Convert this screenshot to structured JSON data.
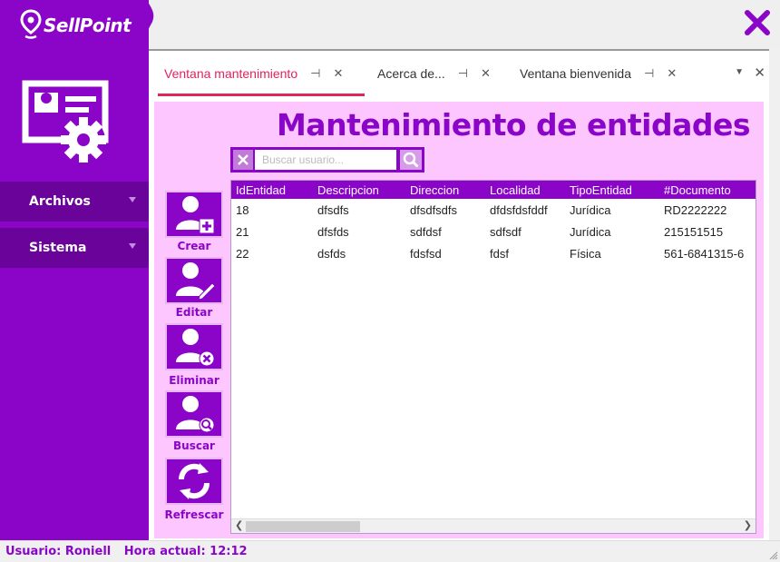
{
  "app": {
    "name": "SellPoint"
  },
  "colors": {
    "brand": "#8a05c8",
    "active_tab": "#e0245e",
    "content_bg": "#fec6ff"
  },
  "sidebar": {
    "items": [
      {
        "label": "Archivos"
      },
      {
        "label": "Sistema"
      }
    ]
  },
  "tabs": [
    {
      "label": "Ventana mantenimiento",
      "active": true
    },
    {
      "label": "Acerca de...",
      "active": false
    },
    {
      "label": "Ventana bienvenida",
      "active": false
    }
  ],
  "page": {
    "title": "Mantenimiento de entidades",
    "search_placeholder": "Buscar usuario..."
  },
  "actions": [
    {
      "label": "Crear",
      "icon": "user-add-icon"
    },
    {
      "label": "Editar",
      "icon": "user-edit-icon"
    },
    {
      "label": "Eliminar",
      "icon": "user-delete-icon"
    },
    {
      "label": "Buscar",
      "icon": "user-search-icon"
    },
    {
      "label": "Refrescar",
      "icon": "refresh-icon"
    }
  ],
  "table": {
    "columns": [
      "IdEntidad",
      "Descripcion",
      "Direccion",
      "Localidad",
      "TipoEntidad",
      "#Documento"
    ],
    "rows": [
      [
        "18",
        "dfsdfs",
        "dfsdfsdfs",
        "dfdsfdsfddf",
        "Jurídica",
        "RD2222222"
      ],
      [
        "21",
        "dfsfds",
        "sdfdsf",
        "sdfsdf",
        "Jurídica",
        "215151515"
      ],
      [
        "22",
        "dsfds",
        "fdsfsd",
        "fdsf",
        "Física",
        "561-6841315-6"
      ]
    ]
  },
  "status": {
    "user": "Usuario: Roniell",
    "time": "Hora actual: 12:12"
  }
}
